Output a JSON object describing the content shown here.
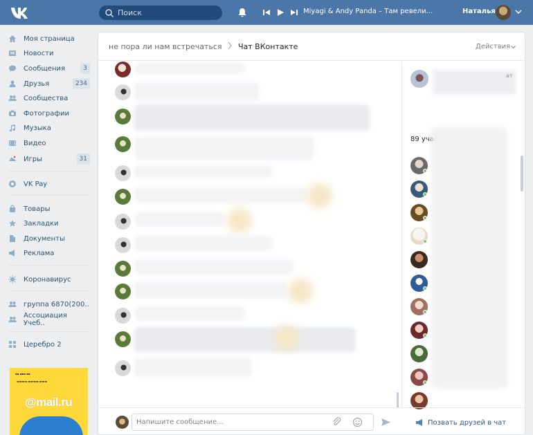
{
  "colors": {
    "header_bg": "#4a76a8",
    "link": "#2a5885",
    "menu_text": "#285473",
    "page_bg": "#edeef0"
  },
  "header": {
    "search_placeholder": "Поиск",
    "now_playing": "Miyagi & Andy Panda – Там ревели...",
    "user_name": "Наталья"
  },
  "sidebar": {
    "items": [
      {
        "label": "Моя страница",
        "icon": "home-icon"
      },
      {
        "label": "Новости",
        "icon": "news-icon"
      },
      {
        "label": "Сообщения",
        "icon": "messages-icon",
        "count": "3"
      },
      {
        "label": "Друзья",
        "icon": "friends-icon",
        "count": "234"
      },
      {
        "label": "Сообщества",
        "icon": "communities-icon"
      },
      {
        "label": "Фотографии",
        "icon": "camera-icon"
      },
      {
        "label": "Музыка",
        "icon": "music-icon"
      },
      {
        "label": "Видео",
        "icon": "video-icon"
      },
      {
        "label": "Игры",
        "icon": "games-icon",
        "count": "31"
      },
      {
        "label": "VK Pay",
        "icon": "vkpay-icon"
      },
      {
        "label": "Товары",
        "icon": "shop-icon"
      },
      {
        "label": "Закладки",
        "icon": "star-icon"
      },
      {
        "label": "Документы",
        "icon": "document-icon"
      },
      {
        "label": "Реклама",
        "icon": "ads-icon"
      },
      {
        "label": "Коронавирус",
        "icon": "virus-icon"
      },
      {
        "label": "группа 6870(200..",
        "icon": "group-icon"
      },
      {
        "label": "Ассоциация Учеб..",
        "icon": "group-icon"
      },
      {
        "label": "Церебро 2",
        "icon": "app-icon"
      }
    ],
    "ad_brand": "@mail.ru"
  },
  "chat": {
    "breadcrumb_parent": "не пора ли нам встречаться",
    "breadcrumb_current": "Чат ВКонтакте",
    "actions_label": "Действия",
    "members_count_label": "89 участ",
    "ellipsis": "ат",
    "input_placeholder": "Напишите сообщение...",
    "invite_label": "Позвать друзей в чат"
  }
}
